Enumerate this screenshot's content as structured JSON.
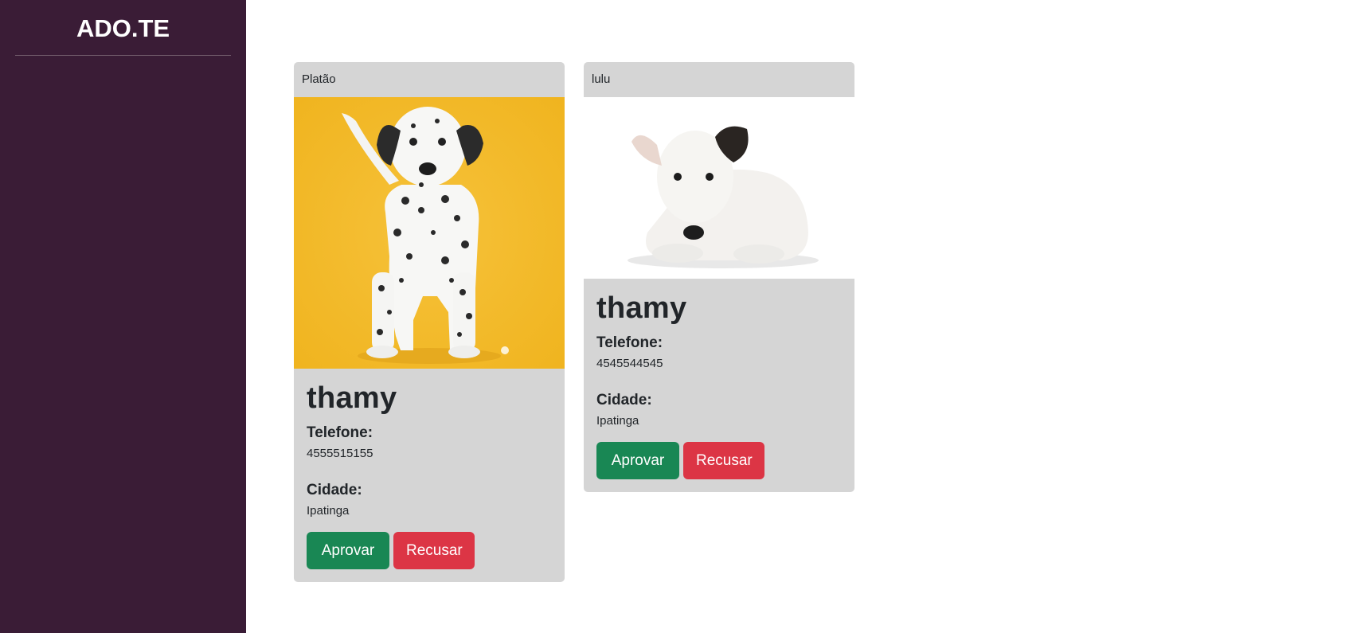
{
  "app": {
    "brand": "ADO.TE"
  },
  "colors": {
    "sidebar": "#3a1c36",
    "card_background": "#d5d5d5",
    "approve": "#198754",
    "refuse": "#dc3545"
  },
  "requests": [
    {
      "pet_name": "Platão",
      "owner_name": "thamy",
      "phone_label": "Telefone:",
      "phone": "4555515155",
      "city_label": "Cidade:",
      "city": "Ipatinga",
      "approve_label": "Aprovar",
      "refuse_label": "Recusar",
      "photo_alt": "Dalmatian puppy on yellow background"
    },
    {
      "pet_name": "lulu",
      "owner_name": "thamy",
      "phone_label": "Telefone:",
      "phone": "4545544545",
      "city_label": "Cidade:",
      "city": "Ipatinga",
      "approve_label": "Aprovar",
      "refuse_label": "Recusar",
      "photo_alt": "White bull terrier puppy lying down"
    }
  ]
}
